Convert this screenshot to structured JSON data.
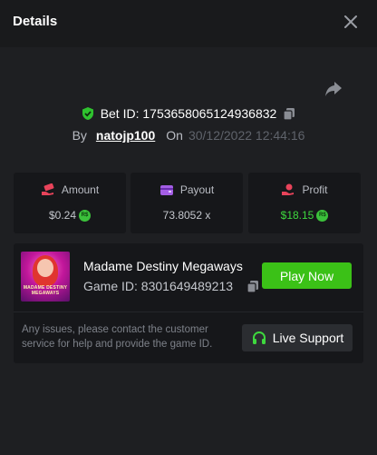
{
  "header": {
    "title": "Details"
  },
  "bet": {
    "id_text": "Bet ID: 1753658065124936832",
    "by_label": "By",
    "user": "natojp100",
    "on_label": "On",
    "datetime": "30/12/2022 12:44:16"
  },
  "stats": {
    "amount": {
      "label": "Amount",
      "value": "$0.24",
      "coin": "R$"
    },
    "payout": {
      "label": "Payout",
      "value": "73.8052 x"
    },
    "profit": {
      "label": "Profit",
      "value": "$18.15",
      "coin": "R$"
    }
  },
  "game": {
    "name": "Madame Destiny Megaways",
    "id_text": "Game ID: 8301649489213",
    "thumb_text": "MADAME DESTINY MEGAWAYS",
    "play_label": "Play Now"
  },
  "support": {
    "message": "Any issues, please contact the customer service for help and provide the game ID.",
    "button_label": "Live Support"
  },
  "colors": {
    "background": "#1e1f22",
    "panel": "#16171a",
    "accent_green": "#3bc117",
    "profit_green": "#3ed83e"
  }
}
